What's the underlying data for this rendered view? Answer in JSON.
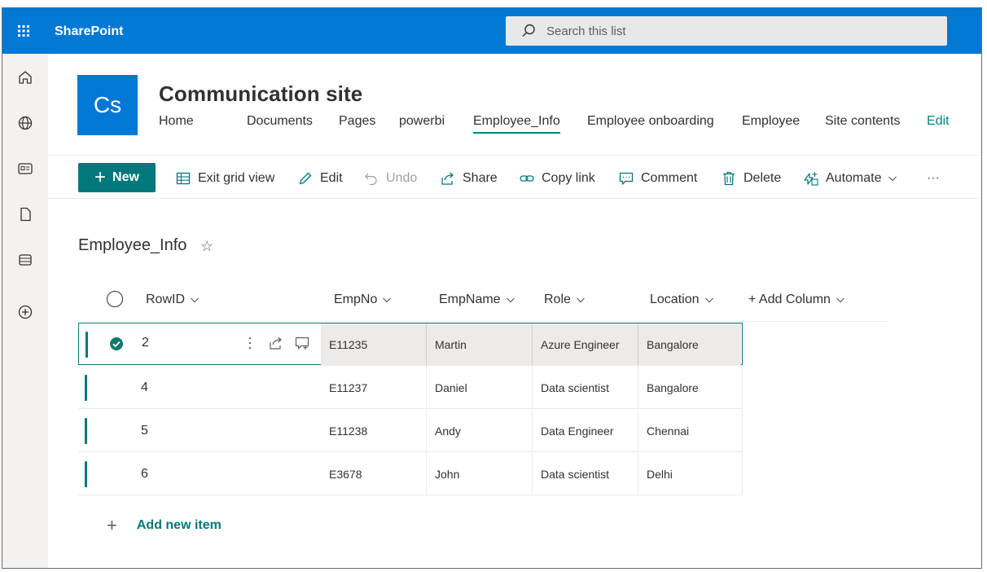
{
  "suitebar": {
    "brand": "SharePoint",
    "search_placeholder": "Search this list",
    "bg_color": "#0078d4"
  },
  "rail": {
    "items": [
      "home-icon",
      "globe-icon",
      "news-icon",
      "document-icon",
      "list-icon",
      "add-icon"
    ]
  },
  "site": {
    "logo_text": "Cs",
    "title": "Communication site",
    "nav": [
      {
        "label": "Home"
      },
      {
        "label": "Documents"
      },
      {
        "label": "Pages"
      },
      {
        "label": "powerbi"
      },
      {
        "label": "Employee_Info",
        "active": true
      },
      {
        "label": "Employee onboarding"
      },
      {
        "label": "Employee"
      },
      {
        "label": "Site contents"
      },
      {
        "label": "Edit"
      }
    ]
  },
  "commandbar": {
    "new_label": "New",
    "exit_grid_label": "Exit grid view",
    "edit_label": "Edit",
    "undo_label": "Undo",
    "share_label": "Share",
    "copy_link_label": "Copy link",
    "comment_label": "Comment",
    "delete_label": "Delete",
    "automate_label": "Automate",
    "more_label": "···",
    "accent_color": "#03787c"
  },
  "list": {
    "title": "Employee_Info",
    "star": "☆",
    "columns": {
      "rowid": "RowID",
      "empno": "EmpNo",
      "empname": "EmpName",
      "role": "Role",
      "location": "Location",
      "add_column": "+ Add Column"
    },
    "rows": [
      {
        "rowid": "2",
        "empno": "E11235",
        "empname": "Martin",
        "role": "Azure Engineer",
        "location": "Bangalore",
        "selected": true
      },
      {
        "rowid": "4",
        "empno": "E11237",
        "empname": "Daniel",
        "role": "Data scientist",
        "location": "Bangalore"
      },
      {
        "rowid": "5",
        "empno": "E11238",
        "empname": "Andy",
        "role": "Data Engineer",
        "location": "Chennai"
      },
      {
        "rowid": "6",
        "empno": "E3678",
        "empname": "John",
        "role": "Data scientist",
        "location": "Delhi"
      }
    ],
    "add_item_plus": "+",
    "add_item_label": "Add new item"
  }
}
